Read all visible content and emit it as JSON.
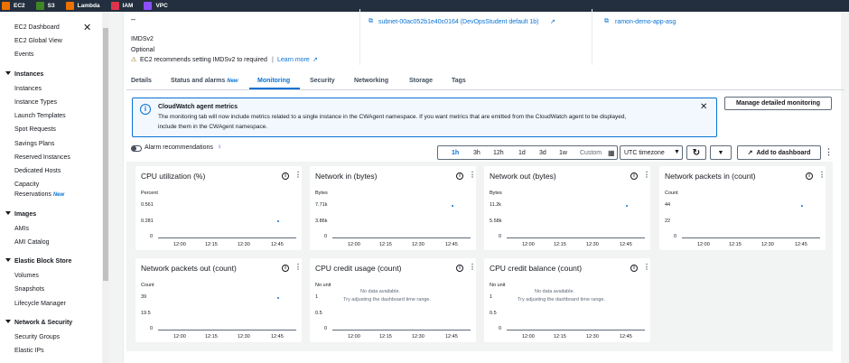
{
  "topbar": {
    "services": [
      {
        "label": "EC2",
        "color": "#ed7100"
      },
      {
        "label": "S3",
        "color": "#3f8624"
      },
      {
        "label": "Lambda",
        "color": "#ed7100"
      },
      {
        "label": "IAM",
        "color": "#dd344c"
      },
      {
        "label": "VPC",
        "color": "#8c4fff"
      }
    ]
  },
  "sidebar": {
    "items": [
      {
        "label": "EC2 Dashboard"
      },
      {
        "label": "EC2 Global View"
      },
      {
        "label": "Events"
      }
    ],
    "sections": [
      {
        "title": "Instances",
        "items": [
          "Instances",
          "Instance Types",
          "Launch Templates",
          "Spot Requests",
          "Savings Plans",
          "Reserved Instances",
          "Dedicated Hosts",
          "Capacity",
          "Reservations"
        ]
      },
      {
        "title": "Images",
        "items": [
          "AMIs",
          "AMI Catalog"
        ]
      },
      {
        "title": "Elastic Block Store",
        "items": [
          "Volumes",
          "Snapshots",
          "Lifecycle Manager"
        ]
      },
      {
        "title": "Network & Security",
        "items": [
          "Security Groups",
          "Elastic IPs"
        ]
      }
    ],
    "new_badge": "New"
  },
  "details": {
    "dash": "–",
    "imds_label": "IMDSv2",
    "imds_value": "Optional",
    "imds_warning": "EC2 recommends setting IMDSv2 to required",
    "learn_more": "Learn more",
    "subnet": "subnet-00ac052b1e40c0164 (DevOpsStudent default 1b)",
    "asg": "ramon-demo-app-asg"
  },
  "tabs": [
    "Details",
    "Status and alarms",
    "Monitoring",
    "Security",
    "Networking",
    "Storage",
    "Tags"
  ],
  "tab_new": "New",
  "banner": {
    "title": "CloudWatch agent metrics",
    "line1": "The monitoring tab will now include metrics related to a single instance in the CWAgent namespace. If you want metrics that are emitted from the CloudWatch agent to be displayed,",
    "line2": "include them in the CWAgent namespace."
  },
  "manage_button": "Manage detailed monitoring",
  "alarm_toggle": "Alarm recommendations",
  "time_ranges": [
    "1h",
    "3h",
    "12h",
    "1d",
    "3d",
    "1w"
  ],
  "selected_range": "1h",
  "custom": "Custom",
  "timezone": "UTC timezone",
  "add_dashboard": "Add to dashboard",
  "chart_data": [
    {
      "type": "scatter",
      "title": "CPU utilization (%)",
      "ylabel": "Percent",
      "ticks": [
        "0.561",
        "0.281",
        "0"
      ],
      "ylim": [
        0,
        0.561
      ],
      "x": [
        "12:00",
        "12:15",
        "12:30",
        "12:45"
      ],
      "points": [
        {
          "x": "12:45",
          "y": 0.281
        }
      ]
    },
    {
      "type": "scatter",
      "title": "Network in (bytes)",
      "ylabel": "Bytes",
      "ticks": [
        "7.71k",
        "3.86k",
        "0"
      ],
      "ylim": [
        0,
        7710
      ],
      "x": [
        "12:00",
        "12:15",
        "12:30",
        "12:45"
      ],
      "points": [
        {
          "x": "12:45",
          "y": 7710
        }
      ]
    },
    {
      "type": "scatter",
      "title": "Network out (bytes)",
      "ylabel": "Bytes",
      "ticks": [
        "11.2k",
        "5.58k",
        "0"
      ],
      "ylim": [
        0,
        11200
      ],
      "x": [
        "12:00",
        "12:15",
        "12:30",
        "12:45"
      ],
      "points": [
        {
          "x": "12:45",
          "y": 11200
        }
      ]
    },
    {
      "type": "scatter",
      "title": "Network packets in (count)",
      "ylabel": "Count",
      "ticks": [
        "44",
        "22",
        "0"
      ],
      "ylim": [
        0,
        44
      ],
      "x": [
        "12:00",
        "12:15",
        "12:30",
        "12:45"
      ],
      "points": [
        {
          "x": "12:45",
          "y": 44
        }
      ]
    },
    {
      "type": "scatter",
      "title": "Network packets out (count)",
      "ylabel": "Count",
      "ticks": [
        "39",
        "19.5",
        "0"
      ],
      "ylim": [
        0,
        39
      ],
      "x": [
        "12:00",
        "12:15",
        "12:30",
        "12:45"
      ],
      "points": [
        {
          "x": "12:45",
          "y": 39
        }
      ]
    },
    {
      "type": "scatter",
      "title": "CPU credit usage (count)",
      "ylabel": "No unit",
      "ticks": [
        "1",
        "0.5",
        "0"
      ],
      "ylim": [
        0,
        1
      ],
      "x": [
        "12:00",
        "12:15",
        "12:30",
        "12:45"
      ],
      "points": [],
      "no_data_1": "No data available.",
      "no_data_2": "Try adjusting the dashboard time range."
    },
    {
      "type": "scatter",
      "title": "CPU credit balance (count)",
      "ylabel": "No unit",
      "ticks": [
        "1",
        "0.5",
        "0"
      ],
      "ylim": [
        0,
        1
      ],
      "x": [
        "12:00",
        "12:15",
        "12:30",
        "12:45"
      ],
      "points": [],
      "no_data_1": "No data available.",
      "no_data_2": "Try adjusting the dashboard time range."
    }
  ]
}
